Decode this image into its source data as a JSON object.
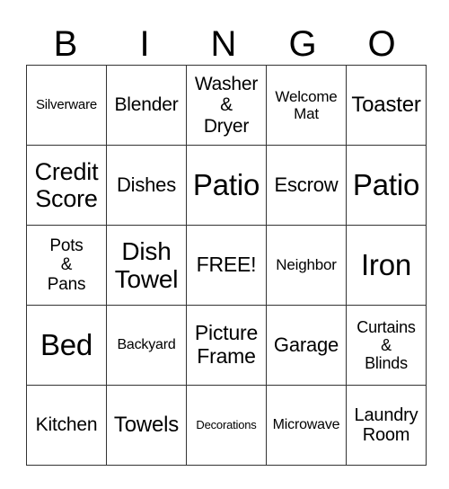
{
  "header": [
    "B",
    "I",
    "N",
    "G",
    "O"
  ],
  "rows": [
    [
      {
        "text": "Silverware",
        "size": 15
      },
      {
        "text": "Blender",
        "size": 21
      },
      {
        "text": "Washer\n&\nDryer",
        "size": 21
      },
      {
        "text": "Welcome\nMat",
        "size": 17
      },
      {
        "text": "Toaster",
        "size": 24
      }
    ],
    [
      {
        "text": "Credit\nScore",
        "size": 27
      },
      {
        "text": "Dishes",
        "size": 22
      },
      {
        "text": "Patio",
        "size": 33
      },
      {
        "text": "Escrow",
        "size": 22
      },
      {
        "text": "Patio",
        "size": 33
      }
    ],
    [
      {
        "text": "Pots\n&\nPans",
        "size": 19
      },
      {
        "text": "Dish\nTowel",
        "size": 28
      },
      {
        "text": "FREE!",
        "size": 23
      },
      {
        "text": "Neighbor",
        "size": 17
      },
      {
        "text": "Iron",
        "size": 33
      }
    ],
    [
      {
        "text": "Bed",
        "size": 33
      },
      {
        "text": "Backyard",
        "size": 16
      },
      {
        "text": "Picture\nFrame",
        "size": 23
      },
      {
        "text": "Garage",
        "size": 22
      },
      {
        "text": "Curtains\n&\nBlinds",
        "size": 18
      }
    ],
    [
      {
        "text": "Kitchen",
        "size": 21
      },
      {
        "text": "Towels",
        "size": 24
      },
      {
        "text": "Decorations",
        "size": 13
      },
      {
        "text": "Microwave",
        "size": 16
      },
      {
        "text": "Laundry\nRoom",
        "size": 20
      }
    ]
  ]
}
